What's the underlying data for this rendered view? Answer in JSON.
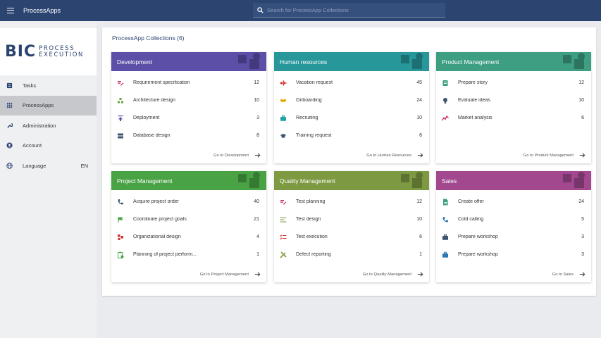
{
  "topbar": {
    "app_title": "ProcessApps",
    "search_placeholder": "Search for ProcessApp Collections"
  },
  "logo": {
    "letters": "BIC",
    "line1": "PROCESS",
    "line2": "EXECUTION"
  },
  "sidebar": {
    "items": [
      {
        "label": "Tasks",
        "icon": "tasks-icon"
      },
      {
        "label": "ProcessApps",
        "icon": "apps-grid-icon",
        "active": true
      },
      {
        "label": "Administration",
        "icon": "wrench-icon"
      },
      {
        "label": "Account",
        "icon": "account-icon"
      },
      {
        "label": "Language",
        "icon": "globe-icon",
        "value": "EN"
      }
    ]
  },
  "panel": {
    "title": "ProcessApp Collections (6)"
  },
  "cards": [
    {
      "title": "Development",
      "color": "#5b4fa8",
      "rows": [
        {
          "label": "Requirement specification",
          "count": "12",
          "icon": "requirement-icon",
          "icon_color": "#c2185b"
        },
        {
          "label": "Architecture design",
          "count": "10",
          "icon": "architecture-icon",
          "icon_color": "#66a33a"
        },
        {
          "label": "Deployment",
          "count": "3",
          "icon": "upload-icon",
          "icon_color": "#5b4fa8"
        },
        {
          "label": "Database design",
          "count": "8",
          "icon": "database-icon",
          "icon_color": "#3f5470"
        }
      ],
      "footer": "Go to Development"
    },
    {
      "title": "Human resources",
      "color": "#27979a",
      "rows": [
        {
          "label": "Vacation request",
          "count": "45",
          "icon": "plane-icon",
          "icon_color": "#d32f2f"
        },
        {
          "label": "Onboarding",
          "count": "24",
          "icon": "handshake-icon",
          "icon_color": "#e3a400"
        },
        {
          "label": "Recruiting",
          "count": "10",
          "icon": "briefcase-icon",
          "icon_color": "#1fa3a3"
        },
        {
          "label": "Training request",
          "count": "6",
          "icon": "graduation-cap-icon",
          "icon_color": "#3f5470"
        }
      ],
      "footer": "Go to Human Resources"
    },
    {
      "title": "Product Management",
      "color": "#3d9e82",
      "rows": [
        {
          "label": "Prepare story",
          "count": "12",
          "icon": "story-icon",
          "icon_color": "#3d9e82"
        },
        {
          "label": "Evaluate ideas",
          "count": "10",
          "icon": "lightbulb-icon",
          "icon_color": "#3f5470"
        },
        {
          "label": "Market analysis",
          "count": "6",
          "icon": "chart-line-icon",
          "icon_color": "#c2185b"
        }
      ],
      "footer": "Go to Product Management"
    },
    {
      "title": "Project Management",
      "color": "#49a345",
      "rows": [
        {
          "label": "Acquire project order",
          "count": "40",
          "icon": "phone-icon",
          "icon_color": "#3f5470"
        },
        {
          "label": "Coordinate project goals",
          "count": "21",
          "icon": "flag-icon",
          "icon_color": "#49a345"
        },
        {
          "label": "Organizational design",
          "count": "4",
          "icon": "org-icon",
          "icon_color": "#d32f2f"
        },
        {
          "label": "Planning of project perform...",
          "count": "1",
          "icon": "clipboard-icon",
          "icon_color": "#49a345"
        }
      ],
      "footer": "Go to Project Management"
    },
    {
      "title": "Quality Management",
      "color": "#7d9a43",
      "rows": [
        {
          "label": "Test planning",
          "count": "12",
          "icon": "test-plan-icon",
          "icon_color": "#c2185b"
        },
        {
          "label": "Test design",
          "count": "10",
          "icon": "test-design-icon",
          "icon_color": "#7d9a43"
        },
        {
          "label": "Test execution",
          "count": "6",
          "icon": "checklist-icon",
          "icon_color": "#d32f2f"
        },
        {
          "label": "Defect reporting",
          "count": "1",
          "icon": "tools-icon",
          "icon_color": "#7d9a43"
        }
      ],
      "footer": "Go to Quality Management"
    },
    {
      "title": "Sales",
      "color": "#a2488f",
      "rows": [
        {
          "label": "Create offer",
          "count": "24",
          "icon": "document-icon",
          "icon_color": "#3d9e82"
        },
        {
          "label": "Cold calling",
          "count": "5",
          "icon": "phone-icon",
          "icon_color": "#2b78b4"
        },
        {
          "label": "Prepare workshop",
          "count": "3",
          "icon": "briefcase-icon",
          "icon_color": "#3f5470"
        },
        {
          "label": "Prepare workshop",
          "count": "3",
          "icon": "briefcase-icon",
          "icon_color": "#2b78b4"
        }
      ],
      "footer": "Go to Sales"
    }
  ]
}
